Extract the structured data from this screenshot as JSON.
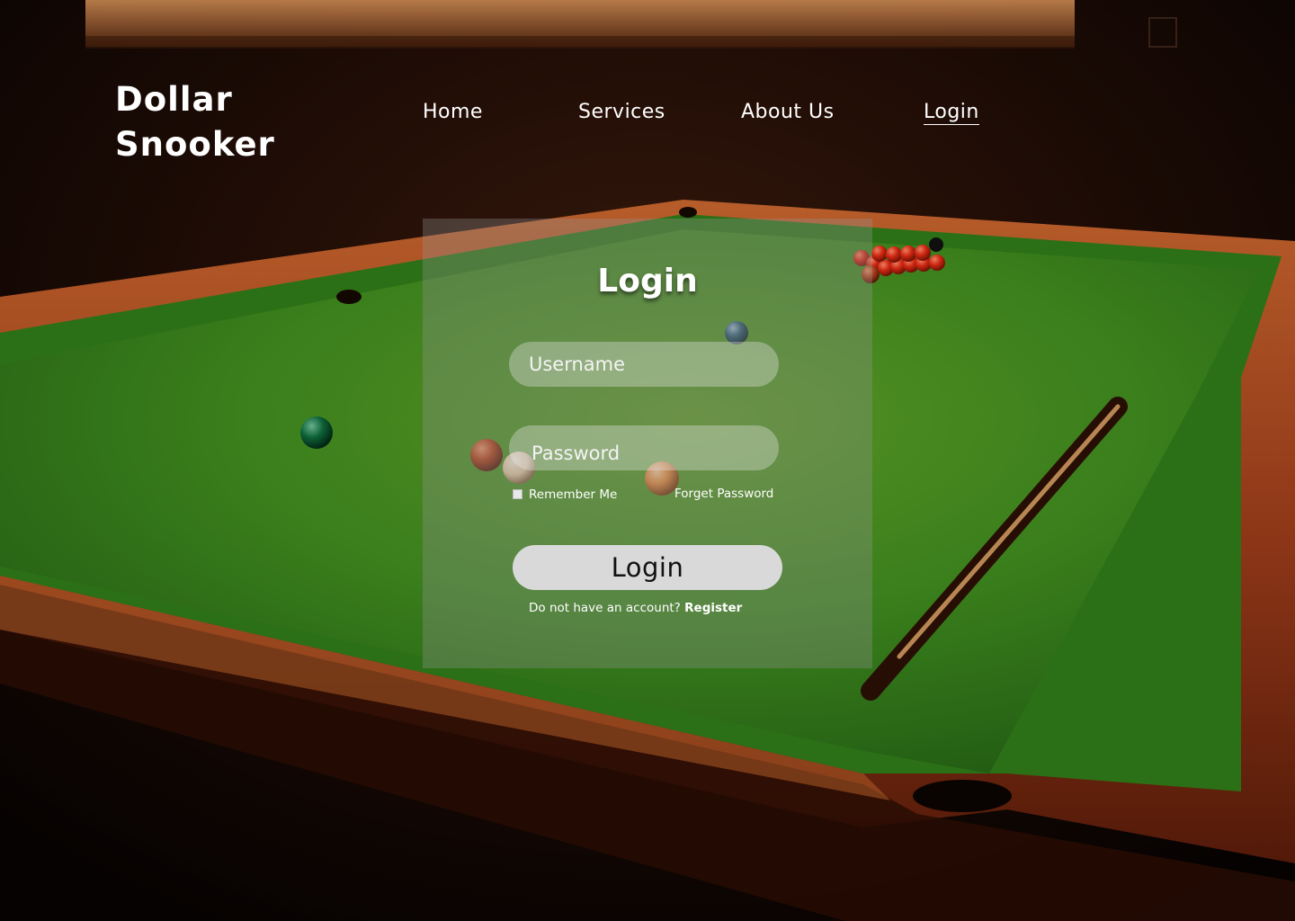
{
  "brand": {
    "line1": "Dollar",
    "line2": "Snooker"
  },
  "nav": {
    "home": "Home",
    "services": "Services",
    "about": "About Us",
    "login": "Login",
    "active": "login"
  },
  "login_form": {
    "title": "Login",
    "username_placeholder": "Username",
    "password_placeholder": "Password",
    "remember_label": "Remember Me",
    "remember_checked": false,
    "forget_label": "Forget Password",
    "submit_label": "Login",
    "register_prompt": "Do not have an account?",
    "register_link": "Register"
  },
  "colors": {
    "felt": "#3d8a1e",
    "wood": "#a0421e",
    "button_bg": "#d9d9d9",
    "text": "#ffffff"
  }
}
